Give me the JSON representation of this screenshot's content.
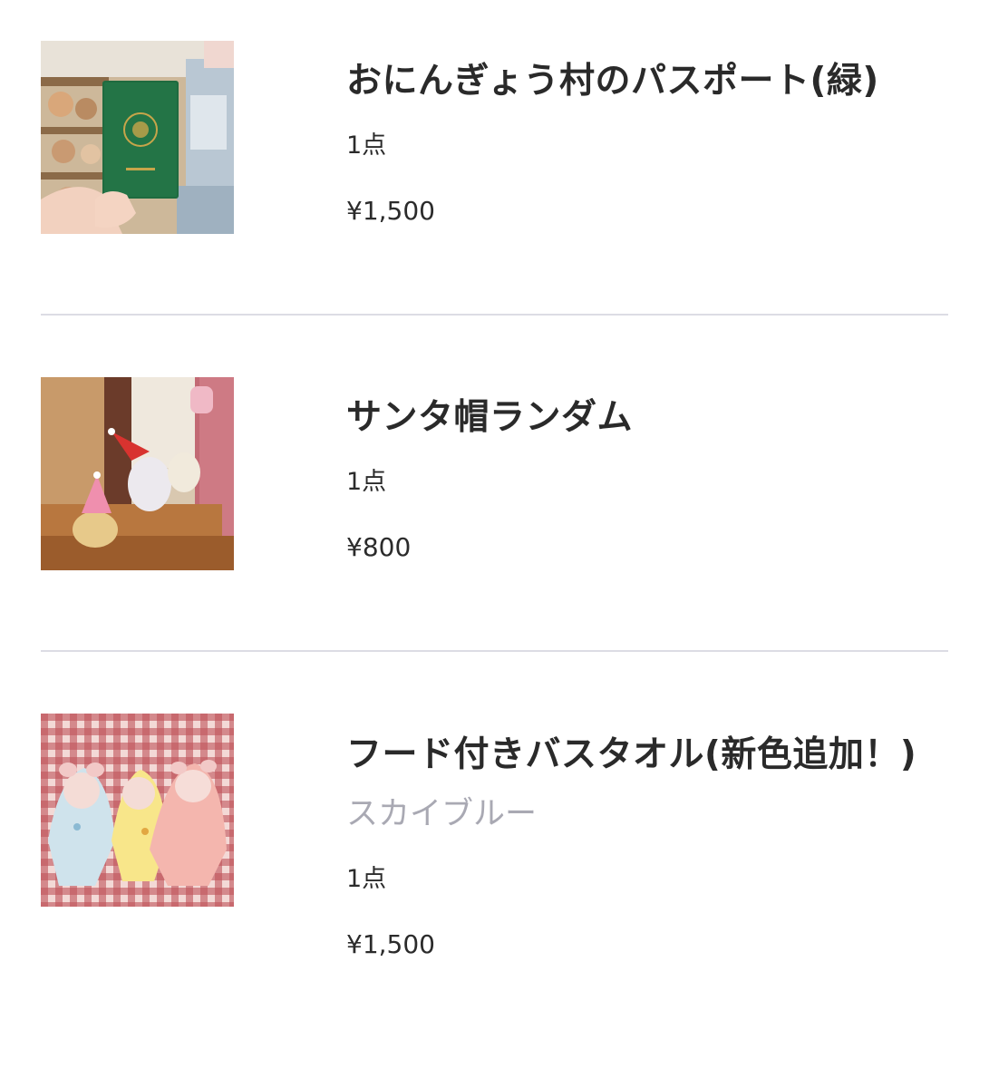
{
  "cart": {
    "items": [
      {
        "name": "おにんぎょう村のパスポート(緑)",
        "quantity": "1点",
        "price": "¥1,500",
        "image": "passport-photo"
      },
      {
        "name": "サンタ帽ランダム",
        "quantity": "1点",
        "price": "¥800",
        "image": "santa-hat-plush-photo"
      },
      {
        "name": "フード付きバスタオル(新色追加！)",
        "variant": "スカイブルー",
        "quantity": "1点",
        "price": "¥1,500",
        "image": "hooded-towel-plush-photo"
      }
    ]
  },
  "colors": {
    "text": "#2b2b2b",
    "variant_text": "#a9a9b3",
    "divider": "#dcdce4",
    "passport_green": "#1f6b3f"
  }
}
